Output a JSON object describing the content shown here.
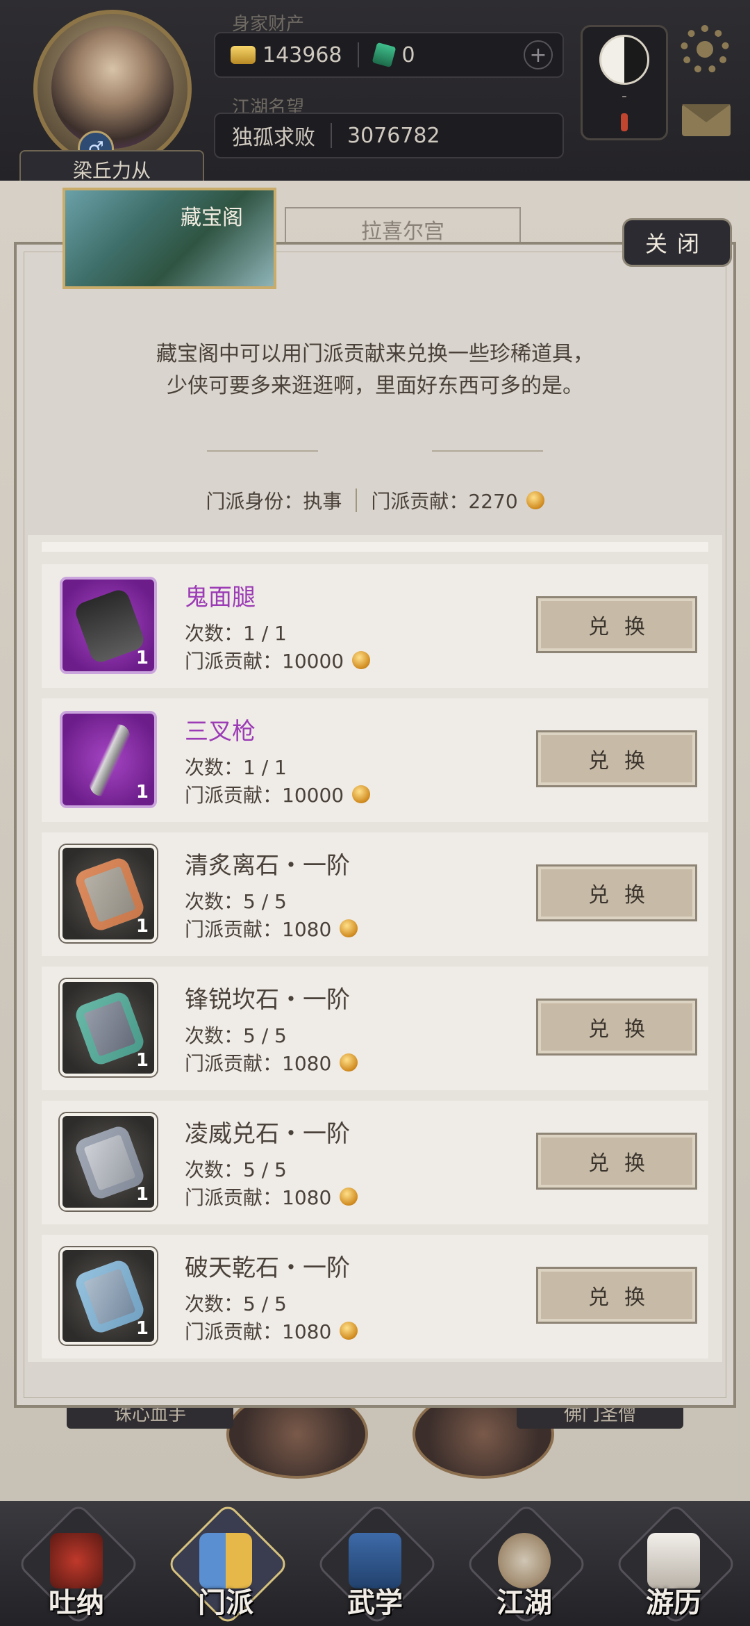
{
  "header": {
    "wealth_label": "身家财产",
    "gold_amount": "143968",
    "jade_amount": "0",
    "fame_label": "江湖名望",
    "fame_title": "独孤求败",
    "fame_value": "3076782",
    "player_name": "梁丘力从",
    "gender_symbol": "♂",
    "taiji_dash": "-"
  },
  "background": {
    "tab_label": "拉喜尔宫",
    "bottom_left_label": "诛心血手",
    "bottom_right_label": "佛门圣僧"
  },
  "dialog": {
    "title": "藏宝阁",
    "close_label": "关闭",
    "desc_line1": "藏宝阁中可以用门派贡献来兑换一些珍稀道具，",
    "desc_line2": "少侠可要多来逛逛啊，里面好东西可多的是。",
    "identity_label": "门派身份：执事",
    "contribution_label": "门派贡献：2270"
  },
  "items": [
    {
      "name": "鬼面腿",
      "count": "次数：1 / 1",
      "cost": "门派贡献：10000",
      "qty": "1",
      "button": "兑换",
      "rarity": "purple"
    },
    {
      "name": "三叉枪",
      "count": "次数：1 / 1",
      "cost": "门派贡献：10000",
      "qty": "1",
      "button": "兑换",
      "rarity": "purple"
    },
    {
      "name": "清炙离石・一阶",
      "count": "次数：5 / 5",
      "cost": "门派贡献：1080",
      "qty": "1",
      "button": "兑换",
      "rarity": "normal"
    },
    {
      "name": "锋锐坎石・一阶",
      "count": "次数：5 / 5",
      "cost": "门派贡献：1080",
      "qty": "1",
      "button": "兑换",
      "rarity": "normal"
    },
    {
      "name": "凌威兑石・一阶",
      "count": "次数：5 / 5",
      "cost": "门派贡献：1080",
      "qty": "1",
      "button": "兑换",
      "rarity": "normal"
    },
    {
      "name": "破天乾石・一阶",
      "count": "次数：5 / 5",
      "cost": "门派贡献：1080",
      "qty": "1",
      "button": "兑换",
      "rarity": "normal"
    }
  ],
  "nav": [
    {
      "label": "吐纳"
    },
    {
      "label": "门派"
    },
    {
      "label": "武学"
    },
    {
      "label": "江湖"
    },
    {
      "label": "游历"
    }
  ],
  "colors": {
    "accent_gold": "#c9ab6a",
    "rare_purple": "#9b3bb5",
    "panel_bg": "#d9d4cd"
  },
  "icons": [
    "gold-ingot-icon",
    "jade-icon",
    "plus-icon",
    "taiji-icon",
    "gear-icon",
    "mail-icon",
    "coin-icon",
    "close-icon"
  ]
}
